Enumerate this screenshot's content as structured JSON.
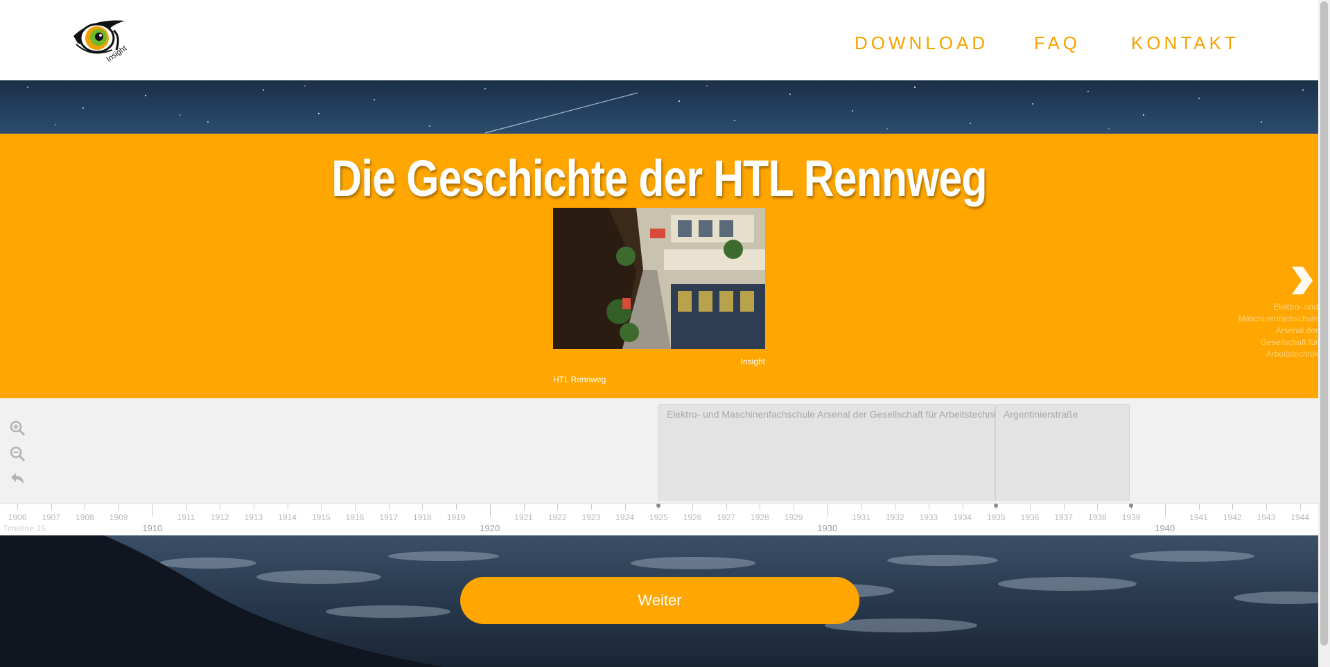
{
  "header": {
    "logo_text": "Insight",
    "nav": [
      {
        "label": "DOWNLOAD"
      },
      {
        "label": "FAQ"
      },
      {
        "label": "KONTAKT"
      }
    ]
  },
  "hero": {
    "title": "Die Geschichte der HTL Rennweg",
    "photo_credit": "Insight",
    "photo_caption": "HTL Rennweg",
    "next_preview": "Elektro- und Maschinenfachschule Arsenal der Gesellschaft für Arbeitstechnik"
  },
  "timeline": {
    "controls": [
      "zoom-in-icon",
      "zoom-out-icon",
      "back-icon"
    ],
    "eras": [
      {
        "label": "Elektro- und Maschinenfachschule Arsenal der Gesellschaft für Arbeitstechnik",
        "start": 1925,
        "end": 1935
      },
      {
        "label": "Argentinierstraße",
        "start": 1935,
        "end": 1939
      }
    ],
    "markers": [
      1925,
      1935,
      1939
    ],
    "year_start": 1906,
    "year_end": 1944,
    "major_years": [
      1910,
      1920,
      1930,
      1940
    ],
    "credit": "Timeline JS"
  },
  "cta": {
    "label": "Weiter"
  },
  "colors": {
    "accent": "#ffa600",
    "nav": "#f5a300"
  }
}
